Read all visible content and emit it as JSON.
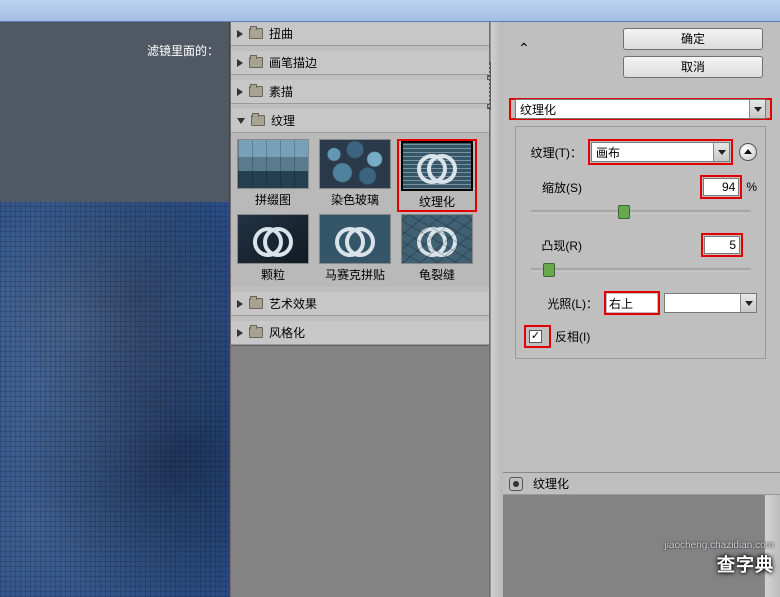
{
  "sidebar_label": "滤镜里面的：",
  "tree": {
    "cat_distort": "扭曲",
    "cat_brush": "画笔描边",
    "cat_sketch": "素描",
    "cat_texture": "纹理",
    "cat_art": "艺术效果",
    "cat_stylize": "风格化"
  },
  "thumbs": {
    "t1": "拼缀图",
    "t2": "染色玻璃",
    "t3": "纹理化",
    "t4": "颗粒",
    "t5": "马赛克拼贴",
    "t6": "龟裂缝"
  },
  "buttons": {
    "ok": "确定",
    "cancel": "取消"
  },
  "options": {
    "filter_dd": "纹理化",
    "texture_label": "纹理(T)：",
    "texture_value": "画布",
    "scale_label": "缩放(S)",
    "scale_value": "94",
    "relief_label": "凸现(R)",
    "relief_value": "5",
    "light_label": "光照(L)：",
    "light_value": "右上",
    "invert_label": "反相(I)"
  },
  "layer_name": "纹理化",
  "watermark": "查字典",
  "watermark_sub": "jiaocheng.chazidian.com"
}
